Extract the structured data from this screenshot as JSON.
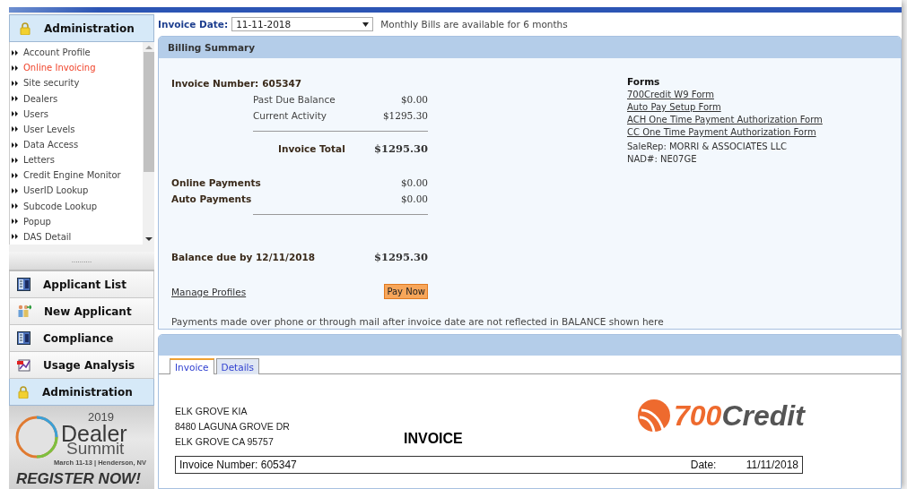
{
  "sidebar": {
    "header": {
      "title": "Administration",
      "kind": "lock"
    },
    "menu": [
      {
        "label": "Account Profile",
        "selected": false
      },
      {
        "label": "Online Invoicing",
        "selected": true
      },
      {
        "label": "Site security",
        "selected": false
      },
      {
        "label": "Dealers",
        "selected": false
      },
      {
        "label": "Users",
        "selected": false
      },
      {
        "label": "User Levels",
        "selected": false
      },
      {
        "label": "Data Access",
        "selected": false
      },
      {
        "label": "Letters",
        "selected": false
      },
      {
        "label": "Credit Engine Monitor",
        "selected": false
      },
      {
        "label": "UserID Lookup",
        "selected": false
      },
      {
        "label": "Subcode Lookup",
        "selected": false
      },
      {
        "label": "Popup",
        "selected": false
      },
      {
        "label": "DAS Detail",
        "selected": false
      }
    ],
    "splitter": "..........",
    "sections": [
      {
        "label": "Applicant List",
        "kind": "list",
        "selected": false
      },
      {
        "label": "New Applicant",
        "kind": "people",
        "selected": false
      },
      {
        "label": "Compliance",
        "kind": "list",
        "selected": false
      },
      {
        "label": "Usage Analysis",
        "kind": "chart",
        "selected": false
      },
      {
        "label": "Administration",
        "kind": "lock",
        "selected": true
      }
    ],
    "banner": {
      "year": "2019",
      "title_1": "Dealer",
      "title_2": "Summit",
      "dates": "March 11-13 | Henderson, NV",
      "cta": "REGISTER NOW!"
    }
  },
  "invoice_date": {
    "label": "Invoice Date:",
    "value": "11-11-2018",
    "note": "Monthly Bills are available for 6 months"
  },
  "billing_summary": {
    "title": "Billing Summary",
    "invoice_number": {
      "label": "Invoice Number:",
      "value": "605347"
    },
    "charges": [
      {
        "label": "Past Due Balance",
        "amount": "$0.00"
      },
      {
        "label": "Current Activity",
        "amount": "$1295.30"
      }
    ],
    "total": {
      "label": "Invoice Total",
      "amount": "$1295.30"
    },
    "payments": [
      {
        "label": "Online Payments",
        "amount": "$0.00"
      },
      {
        "label": "Auto Payments",
        "amount": "$0.00"
      }
    ],
    "balance": {
      "label": "Balance due by 12/11/2018",
      "amount": "$1295.30"
    },
    "manage_link": "Manage Profiles",
    "pay_button": "Pay Now",
    "forms": {
      "title": "Forms",
      "links": [
        "700Credit W9 Form",
        "Auto Pay Setup Form",
        "ACH One Time Payment Authorization Form",
        "CC One Time Payment Authorization Form"
      ],
      "sale_rep": "SaleRep: MORRI & ASSOCIATES LLC",
      "nad": "NAD#: NE07GE"
    },
    "footnote": "Payments made over phone or through mail after invoice date are not reflected in BALANCE shown here"
  },
  "invoice_panel": {
    "tabs": [
      {
        "label": "Invoice",
        "selected": true
      },
      {
        "label": "Details",
        "selected": false
      }
    ],
    "address": [
      "ELK GROVE KIA",
      "8480 LAGUNA GROVE DR",
      "ELK GROVE CA 95757"
    ],
    "heading": "INVOICE",
    "logo": {
      "number": "700",
      "name": "Credit"
    },
    "table_row": {
      "invoice_number": "Invoice Number: 605347",
      "date_label": "Date:",
      "date": "11/11/2018"
    }
  }
}
